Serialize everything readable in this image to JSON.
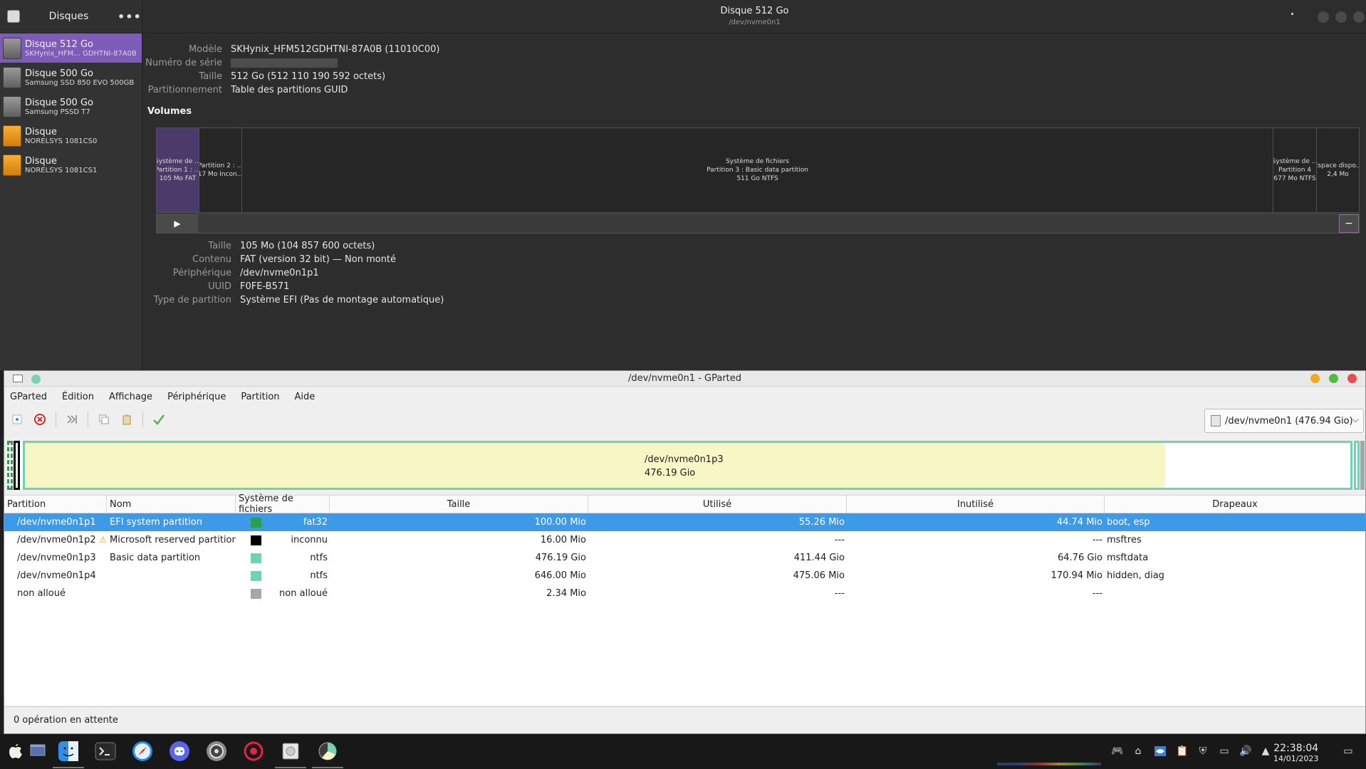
{
  "disks_app": {
    "sidebar_title": "Disques",
    "menu_label": "•••",
    "items": [
      {
        "name": "Disque 512 Go",
        "sub": "SKHynix_HFM... GDHTNI-87A0B",
        "kind": "hdd"
      },
      {
        "name": "Disque 500 Go",
        "sub": "Samsung SSD 850 EVO 500GB",
        "kind": "hdd"
      },
      {
        "name": "Disque 500 Go",
        "sub": "Samsung PSSD T7",
        "kind": "hdd"
      },
      {
        "name": "Disque",
        "sub": "NORELSYS 1081CS0",
        "kind": "usb"
      },
      {
        "name": "Disque",
        "sub": "NORELSYS 1081CS1",
        "kind": "usb"
      }
    ],
    "window_title": "Disque 512 Go",
    "window_subtitle": "/dev/nvme0n1",
    "disk_info": {
      "model_label": "Modèle",
      "model_value": "SKHynix_HFM512GDHTNI-87A0B (11010C00)",
      "serial_label": "Numéro de série",
      "size_label": "Taille",
      "size_value": "512 Go (512 110 190 592 octets)",
      "partitioning_label": "Partitionnement",
      "partitioning_value": "Table des partitions GUID"
    },
    "volumes_title": "Volumes",
    "volumes": [
      {
        "l1": "Système de ...",
        "l2": "Partition 1 : ...",
        "l3": "105 Mo FAT"
      },
      {
        "l1": "",
        "l2": "Partition 2 : ...",
        "l3": "17 Mo Incon..."
      },
      {
        "l1": "Système de fichiers",
        "l2": "Partition 3 : Basic data partition",
        "l3": "511 Go NTFS"
      },
      {
        "l1": "Système de ...",
        "l2": "Partition 4",
        "l3": "677 Mo NTFS"
      },
      {
        "l1": "",
        "l2": "Espace dispo...",
        "l3": "2,4 Mo"
      }
    ],
    "volume_info": {
      "size_label": "Taille",
      "size_value": "105 Mo (104 857 600 octets)",
      "content_label": "Contenu",
      "content_value": "FAT (version 32 bit) — Non monté",
      "device_label": "Périphérique",
      "device_value": "/dev/nvme0n1p1",
      "uuid_label": "UUID",
      "uuid_value": "F0FE-B571",
      "type_label": "Type de partition",
      "type_value": "Système EFI (Pas de montage automatique)"
    }
  },
  "gparted": {
    "title": "/dev/nvme0n1 - GParted",
    "menu": [
      "GParted",
      "Édition",
      "Affichage",
      "Périphérique",
      "Partition",
      "Aide"
    ],
    "device_selector": "/dev/nvme0n1 (476.94 Gio)",
    "graph_label_name": "/dev/nvme0n1p3",
    "graph_label_size": "476.19 Gio",
    "columns": [
      "Partition",
      "Nom",
      "Système de fichiers",
      "Taille",
      "Utilisé",
      "Inutilisé",
      "Drapeaux"
    ],
    "rows": [
      {
        "partition": "/dev/nvme0n1p1",
        "name": "EFI system partition",
        "fs": "fat32",
        "color": "#2e9e4a",
        "size": "100.00 Mio",
        "used": "55.26 Mio",
        "unused": "44.74 Mio",
        "flags": "boot, esp",
        "warning": false
      },
      {
        "partition": "/dev/nvme0n1p2",
        "name": "Microsoft reserved partition",
        "fs": "inconnu",
        "color": "#000000",
        "size": "16.00 Mio",
        "used": "---",
        "unused": "---",
        "flags": "msftres",
        "warning": true
      },
      {
        "partition": "/dev/nvme0n1p3",
        "name": "Basic data partition",
        "fs": "ntfs",
        "color": "#72d2b5",
        "size": "476.19 Gio",
        "used": "411.44 Gio",
        "unused": "64.76 Gio",
        "flags": "msftdata",
        "warning": false
      },
      {
        "partition": "/dev/nvme0n1p4",
        "name": "",
        "fs": "ntfs",
        "color": "#72d2b5",
        "size": "646.00 Mio",
        "used": "475.06 Mio",
        "unused": "170.94 Mio",
        "flags": "hidden, diag",
        "warning": false
      },
      {
        "partition": "non alloué",
        "name": "",
        "fs": "non alloué",
        "color": "#a6a6a6",
        "size": "2.34 Mio",
        "used": "---",
        "unused": "---",
        "flags": "",
        "warning": false
      }
    ],
    "status": "0 opération en attente"
  },
  "taskbar": {
    "time": "22:38:04",
    "date": "14/01/2023"
  },
  "colors": {
    "accent": "#7c5cb8",
    "selection": "#3d9ae8",
    "ntfs": "#72d2b5",
    "used_fill": "#f7f7c5"
  }
}
